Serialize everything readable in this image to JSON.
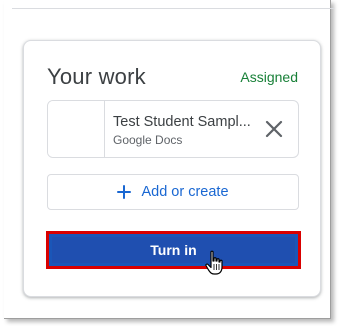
{
  "card": {
    "title": "Your work",
    "status": "Assigned"
  },
  "attachment": {
    "name": "Test Student Sampl...",
    "type": "Google Docs",
    "remove_icon": "close-icon"
  },
  "add_button": {
    "icon": "plus-icon",
    "label": "Add or create"
  },
  "turn_in_button": {
    "label": "Turn in"
  },
  "colors": {
    "status_green": "#188038",
    "accent_blue": "#1967d2",
    "turn_in_bg": "#1f4fb0",
    "highlight_red": "#d90000"
  }
}
